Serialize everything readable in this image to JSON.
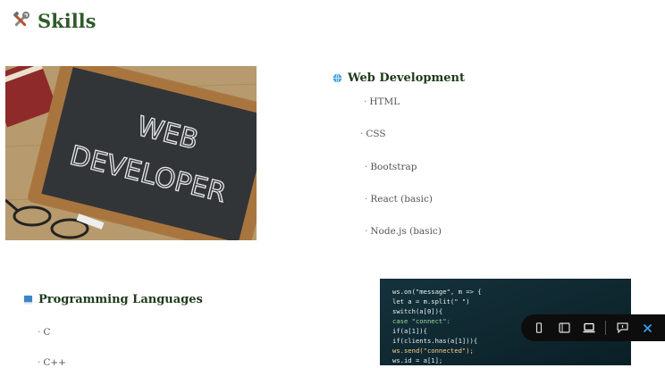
{
  "page": {
    "title": "Skills"
  },
  "web_dev": {
    "heading": "Web Development",
    "items": [
      "HTML",
      "CSS",
      "Bootstrap",
      "React (basic)",
      "Node.js (basic)"
    ]
  },
  "prog_langs": {
    "heading": "Programming Languages",
    "items": [
      "C",
      "C++"
    ]
  },
  "image_board": {
    "line1": "WEB",
    "line2": "DEVELOPER"
  },
  "image_code": {
    "lines": [
      "ws.on(\"message\", m => {",
      "  let a = m.split(\" \")",
      "  switch(a[0]){",
      "    case \"connect\":",
      "      if(a[1]){",
      "        if(clients.has(a[1])){",
      "          ws.send(\"connected\");",
      "          ws.id = a[1];"
    ]
  },
  "toolbar": {
    "icons": [
      "phone-icon",
      "tablet-icon",
      "laptop-icon",
      "comment-icon",
      "close-icon"
    ]
  }
}
